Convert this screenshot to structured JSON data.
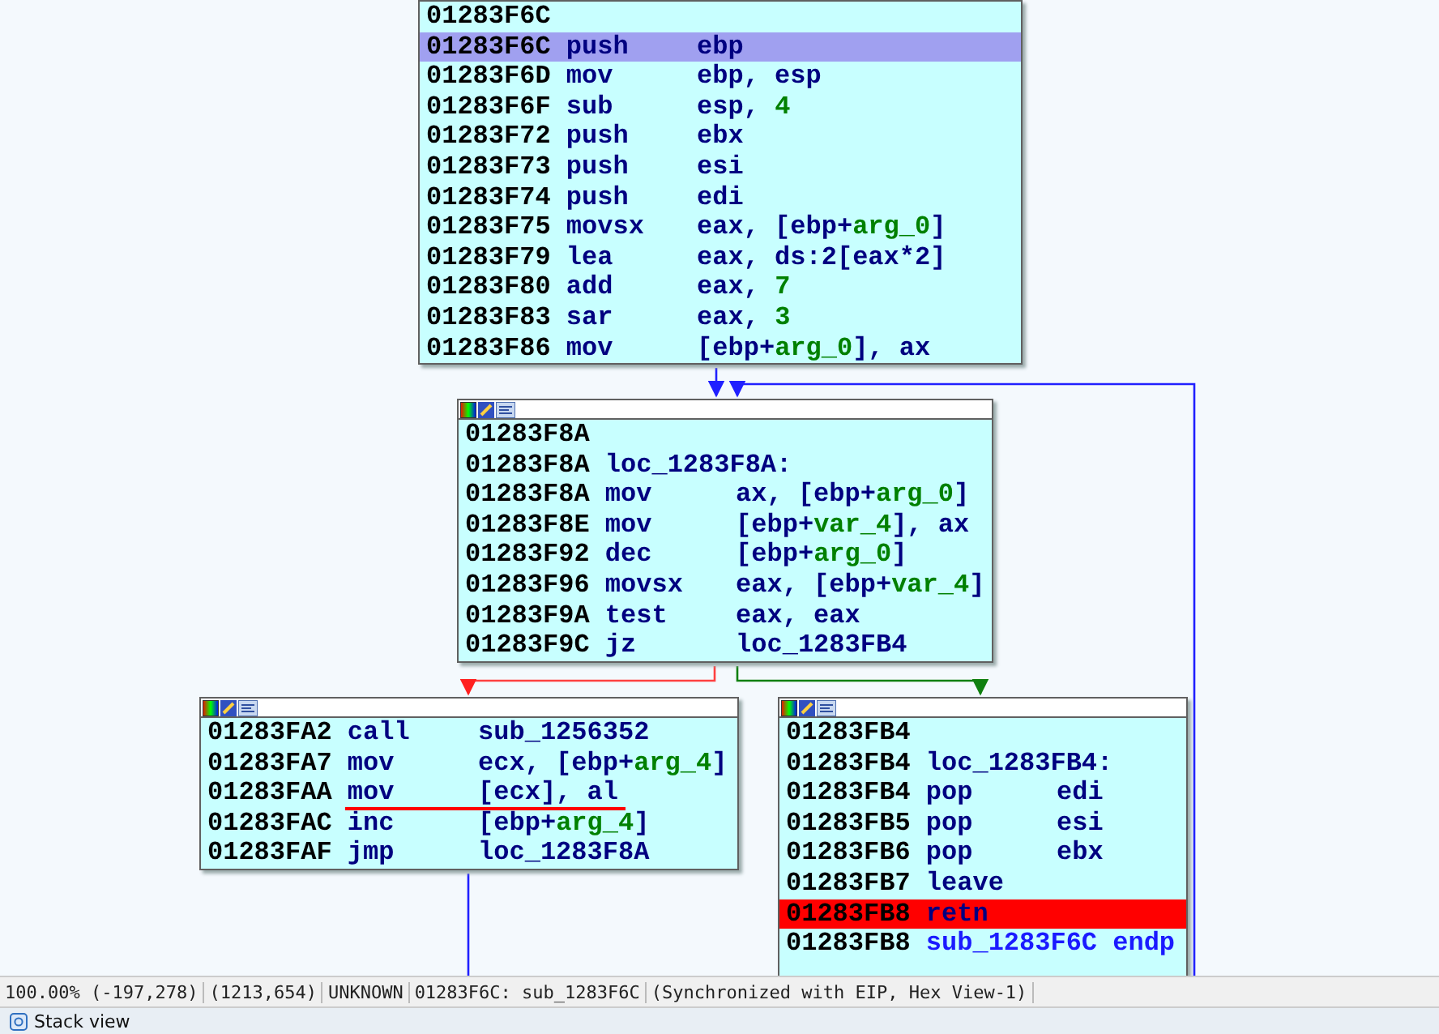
{
  "graph": {
    "blocks": [
      {
        "header": false,
        "lines": [
          {
            "kind": "label",
            "addr": "01283F6C",
            "selected": false,
            "eip": false,
            "underlined": false
          },
          {
            "kind": "insn",
            "addr": "01283F6C",
            "mnem": "push",
            "selected": true,
            "eip": false,
            "underlined": false,
            "ops": [
              {
                "text": "ebp",
                "kind": "plain"
              }
            ]
          },
          {
            "kind": "insn",
            "addr": "01283F6D",
            "mnem": "mov",
            "selected": false,
            "eip": false,
            "underlined": false,
            "ops": [
              {
                "text": "ebp, esp",
                "kind": "plain"
              }
            ]
          },
          {
            "kind": "insn",
            "addr": "01283F6F",
            "mnem": "sub",
            "selected": false,
            "eip": false,
            "underlined": false,
            "ops": [
              {
                "text": "esp, ",
                "kind": "plain"
              },
              {
                "text": "4",
                "kind": "var"
              }
            ]
          },
          {
            "kind": "insn",
            "addr": "01283F72",
            "mnem": "push",
            "selected": false,
            "eip": false,
            "underlined": false,
            "ops": [
              {
                "text": "ebx",
                "kind": "plain"
              }
            ]
          },
          {
            "kind": "insn",
            "addr": "01283F73",
            "mnem": "push",
            "selected": false,
            "eip": false,
            "underlined": false,
            "ops": [
              {
                "text": "esi",
                "kind": "plain"
              }
            ]
          },
          {
            "kind": "insn",
            "addr": "01283F74",
            "mnem": "push",
            "selected": false,
            "eip": false,
            "underlined": false,
            "ops": [
              {
                "text": "edi",
                "kind": "plain"
              }
            ]
          },
          {
            "kind": "insn",
            "addr": "01283F75",
            "mnem": "movsx",
            "selected": false,
            "eip": false,
            "underlined": false,
            "ops": [
              {
                "text": "eax, [ebp+",
                "kind": "plain"
              },
              {
                "text": "arg_0",
                "kind": "var"
              },
              {
                "text": "]",
                "kind": "plain"
              }
            ]
          },
          {
            "kind": "insn",
            "addr": "01283F79",
            "mnem": "lea",
            "selected": false,
            "eip": false,
            "underlined": false,
            "ops": [
              {
                "text": "eax, ds:2[eax*2]",
                "kind": "plain"
              }
            ]
          },
          {
            "kind": "insn",
            "addr": "01283F80",
            "mnem": "add",
            "selected": false,
            "eip": false,
            "underlined": false,
            "ops": [
              {
                "text": "eax, ",
                "kind": "plain"
              },
              {
                "text": "7",
                "kind": "var"
              }
            ]
          },
          {
            "kind": "insn",
            "addr": "01283F83",
            "mnem": "sar",
            "selected": false,
            "eip": false,
            "underlined": false,
            "ops": [
              {
                "text": "eax, ",
                "kind": "plain"
              },
              {
                "text": "3",
                "kind": "var"
              }
            ]
          },
          {
            "kind": "insn",
            "addr": "01283F86",
            "mnem": "mov",
            "selected": false,
            "eip": false,
            "underlined": false,
            "ops": [
              {
                "text": "[ebp+",
                "kind": "plain"
              },
              {
                "text": "arg_0",
                "kind": "var"
              },
              {
                "text": "], ax",
                "kind": "plain"
              }
            ]
          }
        ]
      },
      {
        "header": true,
        "lines": [
          {
            "kind": "label",
            "addr": "01283F8A",
            "selected": false,
            "eip": false,
            "underlined": false
          },
          {
            "kind": "label",
            "addr": "01283F8A",
            "selected": false,
            "eip": false,
            "underlined": false,
            "ops": [
              {
                "text": "loc_1283F8A:",
                "kind": "plain"
              }
            ]
          },
          {
            "kind": "insn",
            "addr": "01283F8A",
            "mnem": "mov",
            "selected": false,
            "eip": false,
            "underlined": false,
            "ops": [
              {
                "text": "ax, [ebp+",
                "kind": "plain"
              },
              {
                "text": "arg_0",
                "kind": "var"
              },
              {
                "text": "]",
                "kind": "plain"
              }
            ]
          },
          {
            "kind": "insn",
            "addr": "01283F8E",
            "mnem": "mov",
            "selected": false,
            "eip": false,
            "underlined": false,
            "ops": [
              {
                "text": "[ebp+",
                "kind": "plain"
              },
              {
                "text": "var_4",
                "kind": "var"
              },
              {
                "text": "], ax",
                "kind": "plain"
              }
            ]
          },
          {
            "kind": "insn",
            "addr": "01283F92",
            "mnem": "dec",
            "selected": false,
            "eip": false,
            "underlined": false,
            "ops": [
              {
                "text": "[ebp+",
                "kind": "plain"
              },
              {
                "text": "arg_0",
                "kind": "var"
              },
              {
                "text": "]",
                "kind": "plain"
              }
            ]
          },
          {
            "kind": "insn",
            "addr": "01283F96",
            "mnem": "movsx",
            "selected": false,
            "eip": false,
            "underlined": false,
            "ops": [
              {
                "text": "eax, [ebp+",
                "kind": "plain"
              },
              {
                "text": "var_4",
                "kind": "var"
              },
              {
                "text": "]",
                "kind": "plain"
              }
            ]
          },
          {
            "kind": "insn",
            "addr": "01283F9A",
            "mnem": "test",
            "selected": false,
            "eip": false,
            "underlined": false,
            "ops": [
              {
                "text": "eax, eax",
                "kind": "plain"
              }
            ]
          },
          {
            "kind": "insn",
            "addr": "01283F9C",
            "mnem": "jz",
            "selected": false,
            "eip": false,
            "underlined": false,
            "ops": [
              {
                "text": "loc_1283FB4",
                "kind": "plain"
              }
            ]
          }
        ]
      },
      {
        "header": true,
        "lines": [
          {
            "kind": "insn",
            "addr": "01283FA2",
            "mnem": "call",
            "selected": false,
            "eip": false,
            "underlined": false,
            "ops": [
              {
                "text": "sub_1256352",
                "kind": "plain"
              }
            ]
          },
          {
            "kind": "insn",
            "addr": "01283FA7",
            "mnem": "mov",
            "selected": false,
            "eip": false,
            "underlined": false,
            "ops": [
              {
                "text": "ecx, [ebp+",
                "kind": "plain"
              },
              {
                "text": "arg_4",
                "kind": "var"
              },
              {
                "text": "]",
                "kind": "plain"
              }
            ]
          },
          {
            "kind": "insn",
            "addr": "01283FAA",
            "mnem": "mov",
            "selected": false,
            "eip": false,
            "underlined": true,
            "ops": [
              {
                "text": "[ecx], al",
                "kind": "plain"
              }
            ]
          },
          {
            "kind": "insn",
            "addr": "01283FAC",
            "mnem": "inc",
            "selected": false,
            "eip": false,
            "underlined": false,
            "ops": [
              {
                "text": "[ebp+",
                "kind": "plain"
              },
              {
                "text": "arg_4",
                "kind": "var"
              },
              {
                "text": "]",
                "kind": "plain"
              }
            ]
          },
          {
            "kind": "insn",
            "addr": "01283FAF",
            "mnem": "jmp",
            "selected": false,
            "eip": false,
            "underlined": false,
            "ops": [
              {
                "text": "loc_1283F8A",
                "kind": "plain"
              }
            ]
          }
        ]
      },
      {
        "header": true,
        "lines": [
          {
            "kind": "label",
            "addr": "01283FB4",
            "selected": false,
            "eip": false,
            "underlined": false
          },
          {
            "kind": "label",
            "addr": "01283FB4",
            "selected": false,
            "eip": false,
            "underlined": false,
            "ops": [
              {
                "text": "loc_1283FB4:",
                "kind": "plain"
              }
            ]
          },
          {
            "kind": "insn",
            "addr": "01283FB4",
            "mnem": "pop",
            "selected": false,
            "eip": false,
            "underlined": false,
            "ops": [
              {
                "text": "edi",
                "kind": "plain"
              }
            ]
          },
          {
            "kind": "insn",
            "addr": "01283FB5",
            "mnem": "pop",
            "selected": false,
            "eip": false,
            "underlined": false,
            "ops": [
              {
                "text": "esi",
                "kind": "plain"
              }
            ]
          },
          {
            "kind": "insn",
            "addr": "01283FB6",
            "mnem": "pop",
            "selected": false,
            "eip": false,
            "underlined": false,
            "ops": [
              {
                "text": "ebx",
                "kind": "plain"
              }
            ]
          },
          {
            "kind": "insn",
            "addr": "01283FB7",
            "mnem": "leave",
            "selected": false,
            "eip": false,
            "underlined": false
          },
          {
            "kind": "insn",
            "addr": "01283FB8",
            "mnem": "retn",
            "selected": false,
            "eip": true,
            "underlined": false
          },
          {
            "kind": "label",
            "addr": "01283FB8",
            "selected": false,
            "eip": false,
            "underlined": false,
            "ops": [
              {
                "text": "sub_1283F6C endp",
                "kind": "label"
              }
            ]
          }
        ]
      }
    ]
  },
  "status_bar": [
    "100.00% (-197,278)",
    "(1213,654)",
    "UNKNOWN",
    "01283F6C: sub_1283F6C",
    "(Synchronized with EIP, Hex View-1)"
  ],
  "bottom_tab": {
    "label": "Stack view"
  }
}
